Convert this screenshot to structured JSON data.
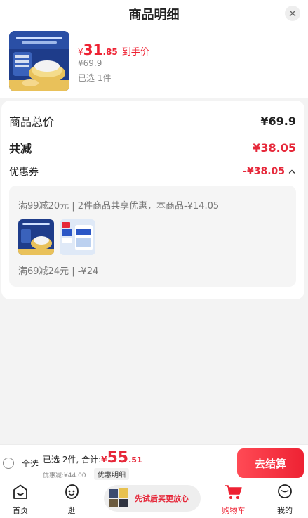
{
  "header": {
    "title": "商品明细",
    "close_icon": "close-icon"
  },
  "product": {
    "price_symbol": "¥",
    "price_int": "31",
    "price_dec": ".85",
    "to_hand": "到手价",
    "original_price": "¥69.9",
    "selected_count": "已选 1件"
  },
  "detail": {
    "total_label": "商品总价",
    "total_value": "¥69.9",
    "reduce_label": "共减",
    "reduce_value": "¥38.05",
    "coupon_label": "优惠券",
    "coupon_value": "-¥38.05",
    "coupon_line1": "满99减20元 | 2件商品共享优惠，本商品-¥14.05",
    "coupon_line2": "满69减24元 | -¥24"
  },
  "bottom": {
    "select_all": "全选",
    "summary": "已选 2件, 合计:",
    "total_symbol": "¥",
    "total_int": "55",
    "total_dec": ".51",
    "discount": "优惠减:¥44.00",
    "detail_link": "优惠明细",
    "checkout": "去结算"
  },
  "tabbar": {
    "items": [
      {
        "label": "首页",
        "icon": "home-icon"
      },
      {
        "label": "逛",
        "icon": "face-icon"
      },
      {
        "label": "购物车",
        "icon": "cart-icon",
        "active": true
      },
      {
        "label": "我的",
        "icon": "user-icon"
      }
    ],
    "promo_text": "先试后买更放心"
  },
  "colors": {
    "accent": "#ee2233",
    "background": "#f3f3f3",
    "card": "#ffffff"
  }
}
